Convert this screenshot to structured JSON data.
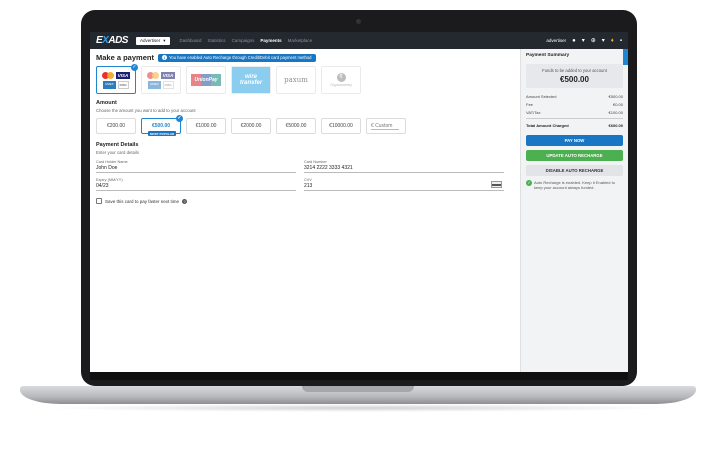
{
  "nav": {
    "logo_pre": "E",
    "logo_x": "X",
    "logo_post": "ADS",
    "role": "Advertiser",
    "links": [
      "Dashboard",
      "Statistics",
      "Campaigns",
      "Payments",
      "Marketplace"
    ],
    "active_link": "Payments",
    "user": "advertiser"
  },
  "page": {
    "title": "Make a payment",
    "info": "You have enabled Auto Recharge through Credit/Debit card payment method"
  },
  "methods": {
    "visa": "VISA",
    "unionpay": "UnionPay",
    "wire_1": "wire",
    "wire_2": "transfer",
    "paxum": "paxum",
    "crypto_label": "Cryptocurrency"
  },
  "amount": {
    "title": "Amount",
    "subtitle": "Choose the amount you want to add to your account",
    "options": [
      "€200.00",
      "€500.00",
      "€1000.00",
      "€2000.00",
      "€5000.00",
      "€10000.00"
    ],
    "selected": "€500.00",
    "popular_badge": "MOST POPULAR",
    "custom_placeholder": "€ Custom"
  },
  "details": {
    "title": "Payment Details",
    "subtitle": "Enter your card details",
    "holder_label": "Card Holder Name",
    "holder_value": "John Doe",
    "number_label": "Card Number",
    "number_value": "3214 2222 3333 4321",
    "expiry_label": "Expiry (MM/YY)",
    "expiry_value": "04/23",
    "cvv_label": "CVV",
    "cvv_value": "213",
    "save_label": "Save this card to pay faster next time"
  },
  "summary": {
    "title": "Payment Summary",
    "funds_label": "Funds to be added to your account",
    "funds_value": "€500.00",
    "rows": [
      {
        "label": "Amount Selected",
        "value": "€500.00"
      },
      {
        "label": "Fee",
        "value": "€0.00"
      },
      {
        "label": "VAT/Tax",
        "value": "€100.00"
      }
    ],
    "total_label": "Total Amount Charged",
    "total_value": "€600.00",
    "pay_label": "PAY NOW",
    "update_label": "UPDATE AUTO RECHARGE",
    "disable_label": "DISABLE AUTO RECHARGE",
    "note": "Auto Recharge is enabled. Keep it Enabled to keep your account always funded."
  },
  "colors": {
    "accent": "#1976c2",
    "success": "#4caf50",
    "nav_bg": "#24282f"
  }
}
